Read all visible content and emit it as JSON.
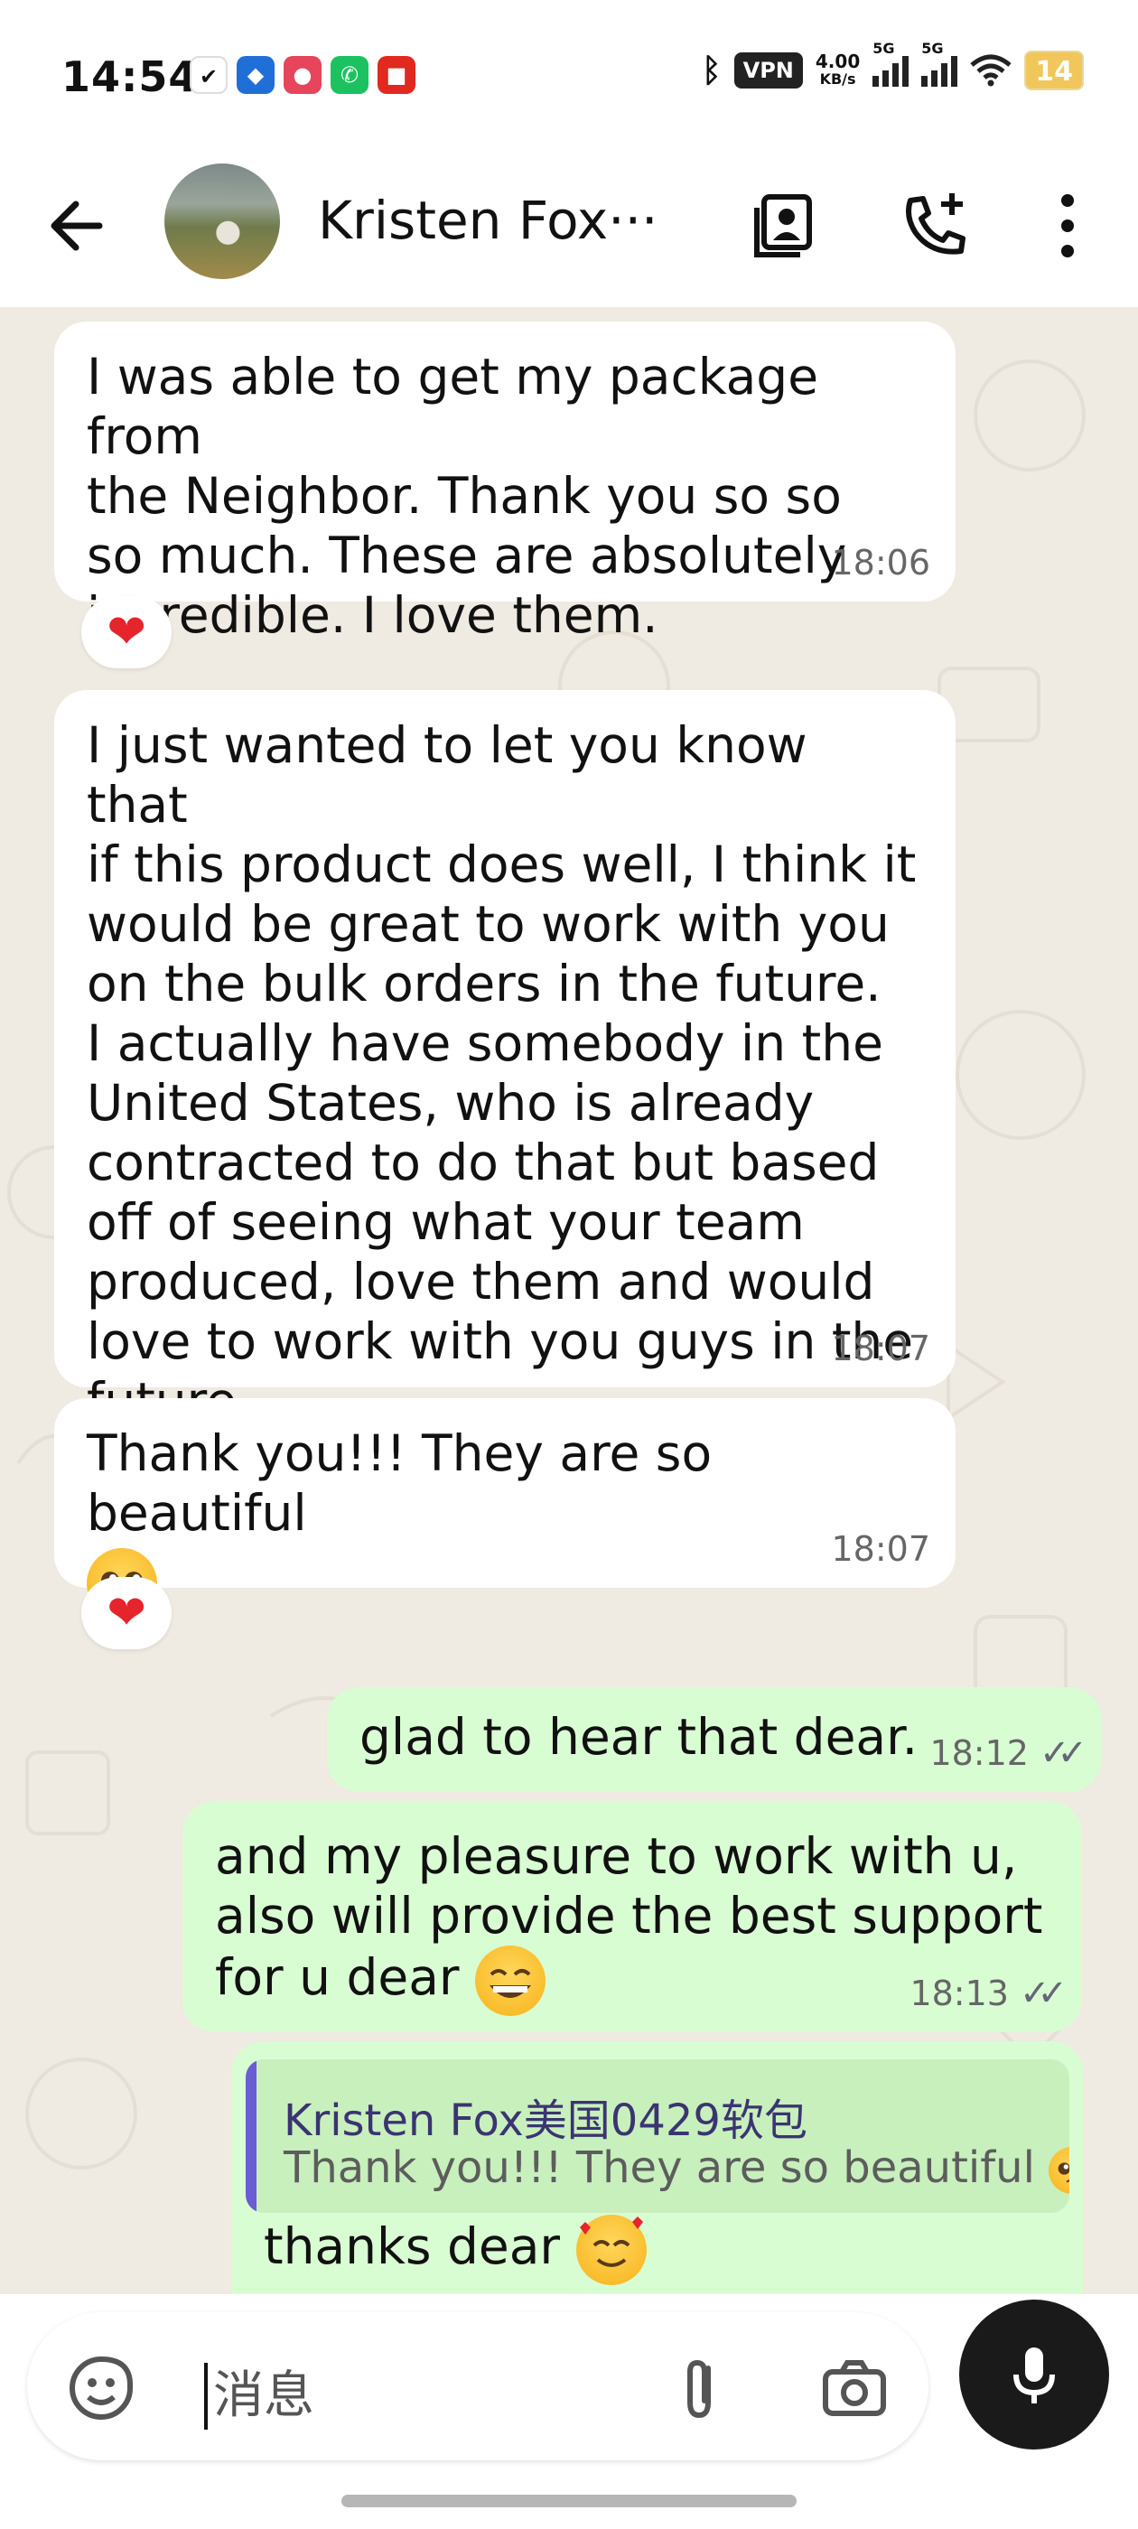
{
  "status_bar": {
    "time": "14:54",
    "vpn_label": "VPN",
    "speed_value": "4.00",
    "speed_unit": "KB/s",
    "net1": "5G",
    "net2": "5G",
    "battery": "14",
    "app_icons": [
      "check-app-icon",
      "blue-app-icon",
      "pink-app-icon",
      "green-phone-app-icon",
      "red-app-icon"
    ]
  },
  "header": {
    "contact_name": "Kristen Fox···",
    "icons": [
      "back-arrow-icon",
      "contact-card-icon",
      "add-call-icon",
      "more-vert-icon"
    ]
  },
  "messages": [
    {
      "direction": "in",
      "lines": [
        "I was able to get my package from",
        "the Neighbor. Thank you so so",
        "so much. These are absolutely",
        "incredible. I love them."
      ],
      "time": "18:06",
      "reaction": "❤"
    },
    {
      "direction": "in",
      "lines": [
        "I just wanted to let you know that",
        "if this product does well, I think it",
        "would be great to work with you",
        "on the bulk orders in the future.",
        "I actually have somebody in the",
        "United States, who is already",
        "contracted to do that but based",
        "off of seeing what your team",
        "produced, love them and would",
        "love to work with you guys in the",
        "future."
      ],
      "time": "18:07"
    },
    {
      "direction": "in",
      "lines": [
        "Thank you!!! They are so beautiful"
      ],
      "time": "18:07",
      "reaction": "❤",
      "emoji": "pleading-face"
    },
    {
      "direction": "out",
      "lines": [
        "glad to hear that dear."
      ],
      "time": "18:12",
      "status": "read"
    },
    {
      "direction": "out",
      "lines": [
        "and my pleasure to work with u,",
        "also will provide the best support",
        "for u dear"
      ],
      "time": "18:13",
      "status": "read",
      "emoji": "grinning-face"
    },
    {
      "direction": "out",
      "reply_to": {
        "name": "Kristen Fox美国0429软包",
        "text": "Thank you!!! They are so beautiful"
      },
      "lines": [
        "thanks dear"
      ],
      "emoji": "smiling-face-with-hearts"
    }
  ],
  "input": {
    "placeholder": "消息",
    "icons": [
      "sticker-icon",
      "attach-icon",
      "camera-icon",
      "mic-icon"
    ]
  },
  "colors": {
    "chat_background": "#efeae2",
    "incoming_bubble": "#ffffff",
    "outgoing_bubble": "#d9fdd3",
    "quote_accent": "#6b5dd3"
  }
}
